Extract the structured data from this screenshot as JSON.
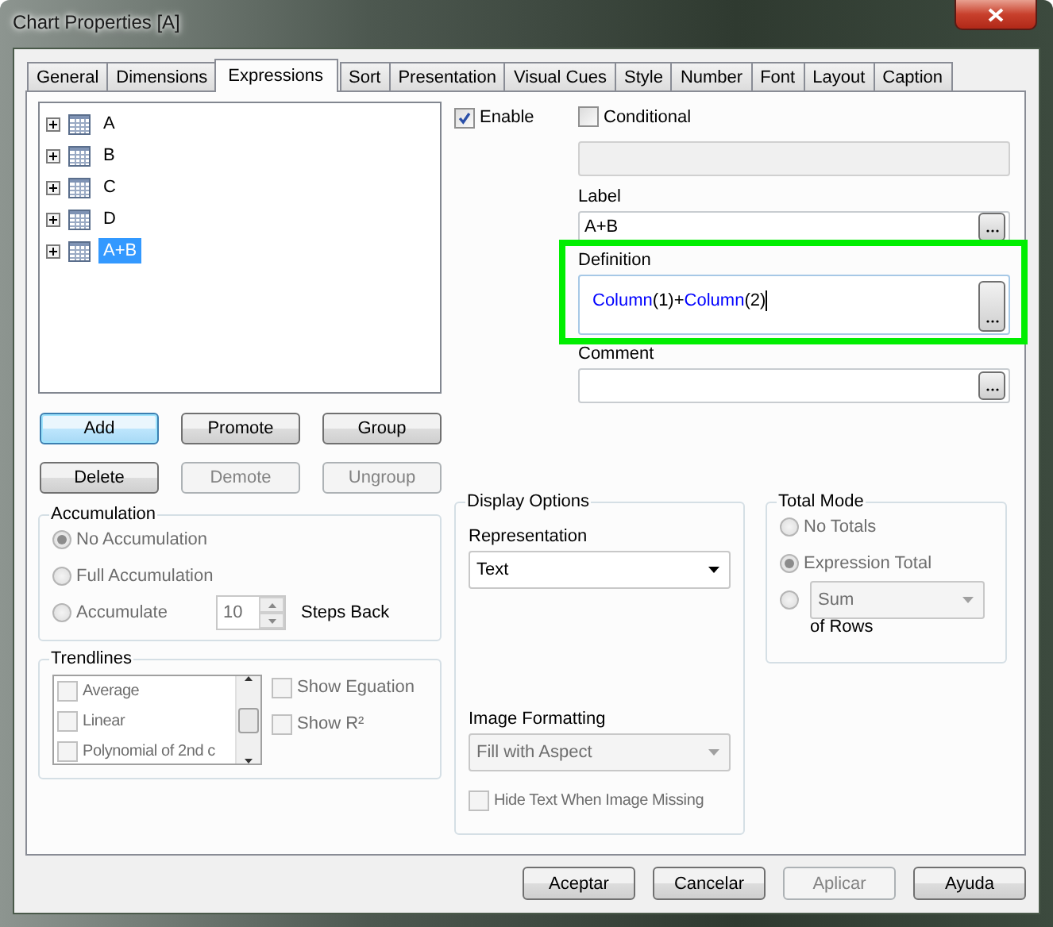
{
  "window": {
    "title": "Chart Properties [A]"
  },
  "tabs": [
    {
      "label": "General",
      "selected": false
    },
    {
      "label": "Dimensions",
      "selected": false
    },
    {
      "label": "Expressions",
      "selected": true
    },
    {
      "label": "Sort",
      "selected": false
    },
    {
      "label": "Presentation",
      "selected": false
    },
    {
      "label": "Visual Cues",
      "selected": false
    },
    {
      "label": "Style",
      "selected": false
    },
    {
      "label": "Number",
      "selected": false
    },
    {
      "label": "Font",
      "selected": false
    },
    {
      "label": "Layout",
      "selected": false
    },
    {
      "label": "Caption",
      "selected": false
    }
  ],
  "expressions": [
    {
      "label": "A",
      "selected": false
    },
    {
      "label": "B",
      "selected": false
    },
    {
      "label": "C",
      "selected": false
    },
    {
      "label": "D",
      "selected": false
    },
    {
      "label": "A+B",
      "selected": true
    }
  ],
  "expression_buttons": [
    {
      "label": "Add",
      "disabled": false,
      "focused": true
    },
    {
      "label": "Promote",
      "disabled": false,
      "focused": false
    },
    {
      "label": "Group",
      "disabled": false,
      "focused": false
    },
    {
      "label": "Delete",
      "disabled": false,
      "focused": false
    },
    {
      "label": "Demote",
      "disabled": true,
      "focused": false
    },
    {
      "label": "Ungroup",
      "disabled": true,
      "focused": false
    }
  ],
  "enable": {
    "label": "Enable",
    "checked": true
  },
  "conditional": {
    "label": "Conditional",
    "checked": false
  },
  "label_field": {
    "label": "Label",
    "value": "A+B"
  },
  "definition": {
    "label": "Definition",
    "highlighted": true,
    "tokens": [
      {
        "text": "Column",
        "kind": "function"
      },
      {
        "text": "(1)+",
        "kind": "plain"
      },
      {
        "text": "Column",
        "kind": "function"
      },
      {
        "text": "(2)",
        "kind": "plain"
      }
    ]
  },
  "comment": {
    "label": "Comment"
  },
  "accumulation": {
    "title": "Accumulation",
    "disabled": true,
    "options": [
      {
        "label": "No Accumulation",
        "selected": true
      },
      {
        "label": "Full Accumulation",
        "selected": false
      },
      {
        "label": "Accumulate",
        "selected": false
      }
    ],
    "steps_value": "10",
    "steps_label": "Steps Back"
  },
  "trendlines": {
    "title": "Trendlines",
    "disabled": true,
    "items": [
      {
        "label": "Average",
        "checked": false
      },
      {
        "label": "Linear",
        "checked": false
      },
      {
        "label": "Polynomial of 2nd c",
        "checked": false
      }
    ],
    "show_equation": {
      "label": "Show Eguation",
      "checked": false
    },
    "show_r2": {
      "label": "Show R²",
      "checked": false
    }
  },
  "display_options": {
    "title": "Display Options",
    "representation": {
      "label": "Representation",
      "value": "Text",
      "disabled": false
    },
    "image_formatting": {
      "label": "Image Formatting",
      "value": "Fill with Aspect",
      "disabled": true
    },
    "hide_text": {
      "label": "Hide Text When Image Missing",
      "checked": false,
      "disabled": true
    }
  },
  "total_mode": {
    "title": "Total Mode",
    "disabled": true,
    "options": [
      {
        "kind": "text",
        "label": "No Totals",
        "selected": false
      },
      {
        "kind": "text",
        "label": "Expression Total",
        "selected": true
      },
      {
        "kind": "dropdown",
        "value": "Sum",
        "selected": false
      }
    ],
    "suffix": "of Rows"
  },
  "dialog_buttons": [
    {
      "label": "Aceptar",
      "disabled": false
    },
    {
      "label": "Cancelar",
      "disabled": false
    },
    {
      "label": "Aplicar",
      "disabled": true
    },
    {
      "label": "Ayuda",
      "disabled": false
    }
  ]
}
